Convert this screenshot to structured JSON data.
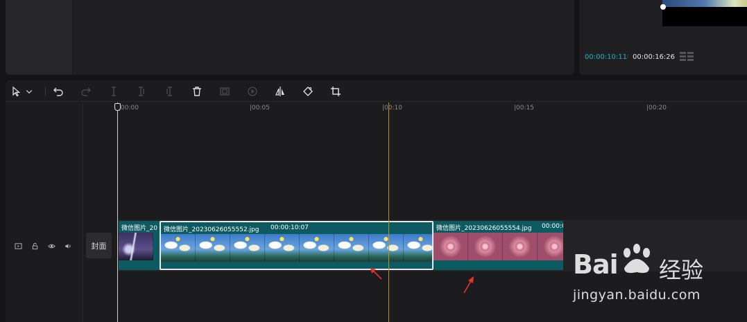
{
  "player": {
    "current_time": "00:00:10:11",
    "separator": "/",
    "total_time": "00:00:16:26"
  },
  "toolbar": {
    "select_tool": "cursor-icon",
    "select_dropdown": "chevron-down-icon",
    "undo": "undo-icon",
    "redo": "redo-icon",
    "split": "split-icon",
    "split_left": "split-left-icon",
    "split_right": "split-right-icon",
    "delete": "trash-icon",
    "freeze": "freeze-frame-icon",
    "reverse": "reverse-play-icon",
    "mirror": "mirror-icon",
    "rotate": "rotate-icon",
    "crop": "crop-icon"
  },
  "ruler": {
    "labels": [
      "|00:00",
      "|00:05",
      "|00:10",
      "|00:15",
      "|00:20"
    ]
  },
  "track": {
    "cover_label": "封面",
    "controls": [
      "video-track-icon",
      "lock-icon",
      "eye-icon",
      "volume-icon"
    ]
  },
  "clips": [
    {
      "label": "微信图片_20",
      "duration": "",
      "style": "storm"
    },
    {
      "label": "微信图片_20230626055552.jpg",
      "duration": "00:00:10:07",
      "style": "sky",
      "selected": true
    },
    {
      "label": "微信图片_20230626055554.jpg",
      "duration": "00:00:0",
      "style": "rose"
    }
  ],
  "watermark": {
    "brand": "Bai",
    "brand_suffix": "经验",
    "url": "jingyan.baidu.com"
  },
  "colors": {
    "accent": "#21b5c8",
    "clip": "#0d5a61",
    "cursor_line": "#b9922e",
    "annotation_arrow": "#e8332a"
  }
}
